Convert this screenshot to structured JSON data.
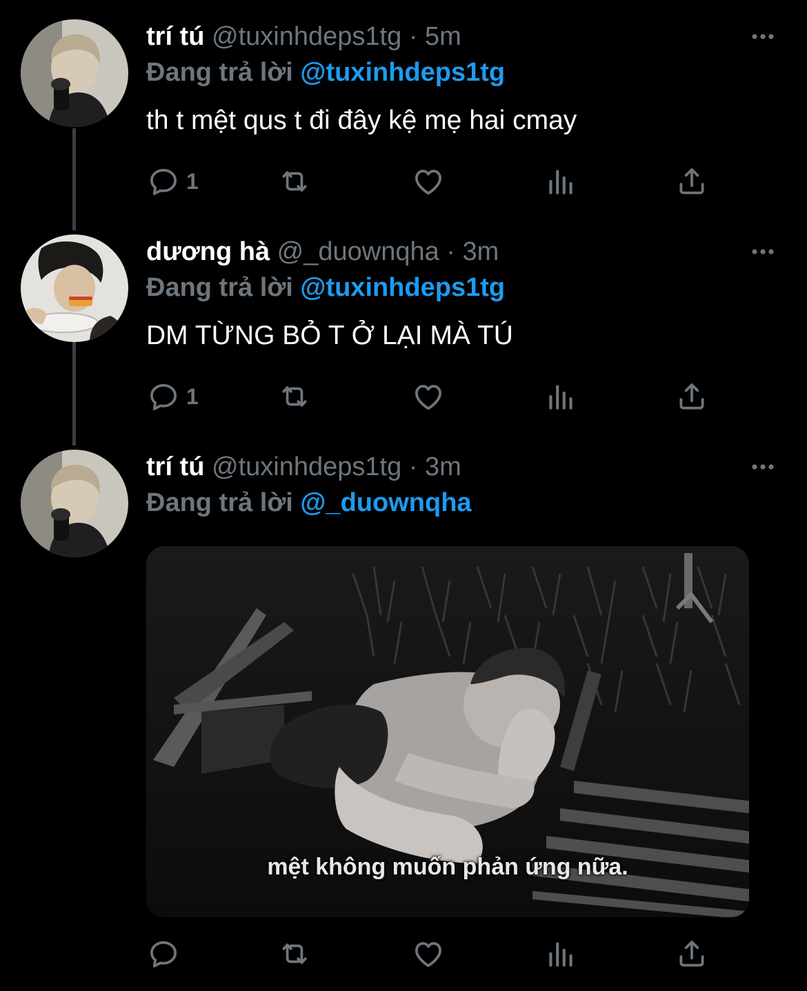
{
  "tweets": [
    {
      "name": "trí tú",
      "handle": "@tuxinhdeps1tg",
      "separator": "·",
      "time": "5m",
      "replying_prefix": "Đang trả lời",
      "replying_to": "@tuxinhdeps1tg",
      "text": "th t mệt qus t đi đây kệ mẹ hai cmay",
      "reply_count": "1"
    },
    {
      "name": "dương hà",
      "handle": "@_duownqha",
      "separator": "·",
      "time": "3m",
      "replying_prefix": "Đang trả lời",
      "replying_to": "@tuxinhdeps1tg",
      "text": "DM TỪNG BỎ T Ở LẠI MÀ TÚ",
      "reply_count": "1"
    },
    {
      "name": "trí tú",
      "handle": "@tuxinhdeps1tg",
      "separator": "·",
      "time": "3m",
      "replying_prefix": "Đang trả lời",
      "replying_to": "@_duownqha",
      "media_caption": "mệt không muốn phản ứng nữa.",
      "reply_count": ""
    }
  ],
  "colors": {
    "background": "#000000",
    "secondary_text": "#6e767d",
    "mention": "#1d9bf0",
    "thread_line": "#3a4046"
  },
  "icons": {
    "reply": "reply-icon",
    "retweet": "retweet-icon",
    "like": "heart-icon",
    "analytics": "analytics-icon",
    "share": "share-icon",
    "more": "more-icon"
  }
}
